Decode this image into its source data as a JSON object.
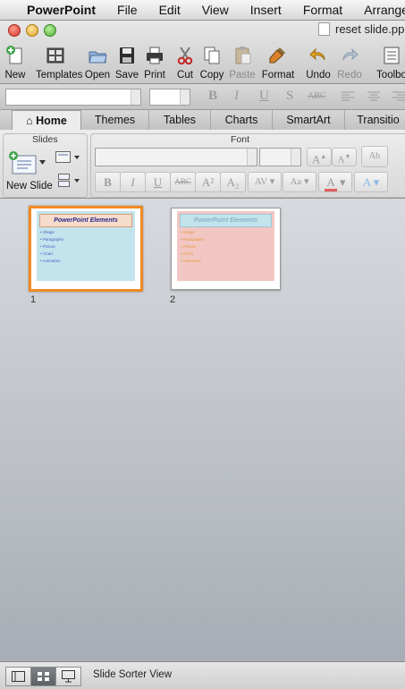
{
  "menubar": {
    "apple_icon": "apple-logo-icon",
    "items": [
      "PowerPoint",
      "File",
      "Edit",
      "View",
      "Insert",
      "Format",
      "Arrange"
    ]
  },
  "window": {
    "title": "reset slide.pp"
  },
  "toolbar": {
    "buttons": [
      {
        "label": "New",
        "icon": "new-document-icon"
      },
      {
        "label": "Templates",
        "icon": "templates-icon"
      },
      {
        "label": "Open",
        "icon": "open-folder-icon"
      },
      {
        "label": "Save",
        "icon": "save-icon"
      },
      {
        "label": "Print",
        "icon": "print-icon"
      },
      {
        "label": "Cut",
        "icon": "cut-icon"
      },
      {
        "label": "Copy",
        "icon": "copy-icon"
      },
      {
        "label": "Paste",
        "icon": "paste-icon",
        "enabled": false
      },
      {
        "label": "Format",
        "icon": "format-painter-icon"
      },
      {
        "label": "Undo",
        "icon": "undo-icon"
      },
      {
        "label": "Redo",
        "icon": "redo-icon",
        "enabled": false
      },
      {
        "label": "Toolbo",
        "icon": "toolbox-icon"
      }
    ]
  },
  "format_bar": {
    "font_name": "",
    "font_size": "",
    "glyphs": [
      "B",
      "I",
      "U",
      "S",
      "ABC"
    ]
  },
  "ribbon": {
    "tabs": [
      "Home",
      "Themes",
      "Tables",
      "Charts",
      "SmartArt",
      "Transitio"
    ],
    "active_tab": "Home",
    "groups": {
      "slides": {
        "title": "Slides",
        "new_slide_label": "New Slide"
      },
      "font": {
        "title": "Font",
        "font_name": "",
        "font_size": "",
        "glyphs": [
          "B",
          "I",
          "U",
          "ABC",
          "A²",
          "A₂",
          "AV",
          "Aa",
          "A",
          "A"
        ]
      }
    }
  },
  "slides": [
    {
      "number": "1",
      "title": "PowerPoint Elements",
      "bullets": [
        "Shape",
        "Paragraphs",
        "Picture",
        "Chart",
        "Animation"
      ],
      "selected": true,
      "title_bg": "#f6dccb",
      "body_bg": "#c3e4ec",
      "title_color": "#2b2a8a",
      "bullet_color": "#4a63c9"
    },
    {
      "number": "2",
      "title": "PowerPoint Elements",
      "bullets": [
        "Shape",
        "Paragraphs",
        "Picture",
        "Chart",
        "Animation"
      ],
      "selected": false,
      "title_bg": "#c3e4ec",
      "body_bg": "#f2c7c3",
      "title_color": "#8cb2c6",
      "bullet_color": "#e39a3f"
    }
  ],
  "statusbar": {
    "view_buttons": [
      "normal-view-icon",
      "slide-sorter-view-icon",
      "slide-show-view-icon"
    ],
    "active_view": "slide-sorter-view-icon",
    "status_text": "Slide Sorter View"
  },
  "colors": {
    "selection_accent": "#f08a24",
    "sorter_background": "#a9aeb6"
  }
}
